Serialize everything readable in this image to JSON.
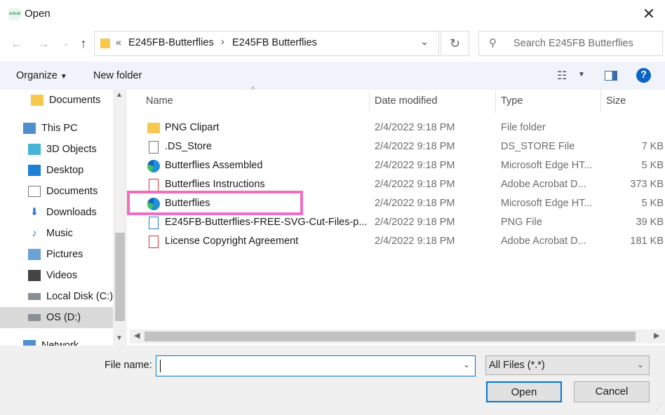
{
  "window": {
    "title": "Open",
    "app_icon_text": "cricut"
  },
  "address": {
    "overflow": "«",
    "crumbs": [
      "E245FB-Butterflies",
      "E245FB Butterflies"
    ]
  },
  "search": {
    "placeholder": "Search E245FB Butterflies"
  },
  "toolbar": {
    "organize_label": "Organize",
    "new_folder_label": "New folder"
  },
  "sidebar": {
    "items": [
      {
        "label": "Documents",
        "icon": "folder-icon"
      },
      {
        "label": "This PC",
        "icon": "pc-icon"
      },
      {
        "label": "3D Objects",
        "icon": "cube-icon"
      },
      {
        "label": "Desktop",
        "icon": "desktop-icon"
      },
      {
        "label": "Documents",
        "icon": "documents-icon"
      },
      {
        "label": "Downloads",
        "icon": "download-icon"
      },
      {
        "label": "Music",
        "icon": "music-icon"
      },
      {
        "label": "Pictures",
        "icon": "pictures-icon"
      },
      {
        "label": "Videos",
        "icon": "videos-icon"
      },
      {
        "label": "Local Disk (C:)",
        "icon": "disk-icon"
      },
      {
        "label": "OS (D:)",
        "icon": "disk-icon"
      },
      {
        "label": "Network",
        "icon": "network-icon"
      }
    ]
  },
  "columns": {
    "name": "Name",
    "date": "Date modified",
    "type": "Type",
    "size": "Size"
  },
  "files": [
    {
      "name": "PNG Clipart",
      "date": "2/4/2022 9:18 PM",
      "type": "File folder",
      "size": "",
      "icon": "folder-icon"
    },
    {
      "name": ".DS_Store",
      "date": "2/4/2022 9:18 PM",
      "type": "DS_STORE File",
      "size": "7 KB",
      "icon": "file-icon"
    },
    {
      "name": "Butterflies Assembled",
      "date": "2/4/2022 9:18 PM",
      "type": "Microsoft Edge HT...",
      "size": "5 KB",
      "icon": "edge-icon"
    },
    {
      "name": "Butterflies Instructions",
      "date": "2/4/2022 9:18 PM",
      "type": "Adobe Acrobat D...",
      "size": "373 KB",
      "icon": "pdf-icon"
    },
    {
      "name": "Butterflies",
      "date": "2/4/2022 9:18 PM",
      "type": "Microsoft Edge HT...",
      "size": "5 KB",
      "icon": "edge-icon"
    },
    {
      "name": "E245FB-Butterflies-FREE-SVG-Cut-Files-p...",
      "date": "2/4/2022 9:18 PM",
      "type": "PNG File",
      "size": "39 KB",
      "icon": "png-icon"
    },
    {
      "name": "License Copyright Agreement",
      "date": "2/4/2022 9:18 PM",
      "type": "Adobe Acrobat D...",
      "size": "181 KB",
      "icon": "pdf-icon"
    }
  ],
  "bottom": {
    "filename_label": "File name:",
    "filename_value": "",
    "filter_value": "All Files (*.*)",
    "open_label": "Open",
    "cancel_label": "Cancel"
  },
  "colors": {
    "highlight": "#f06ec0",
    "accent": "#0078d7",
    "help": "#0a64c8"
  }
}
